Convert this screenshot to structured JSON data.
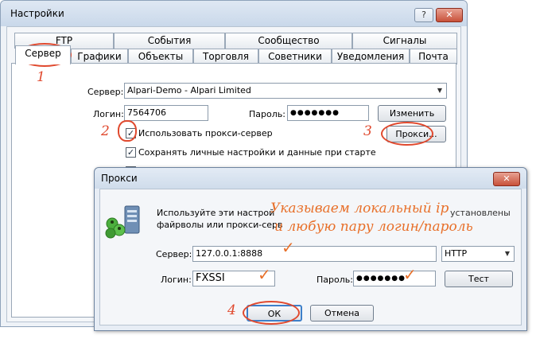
{
  "settings_window": {
    "title": "Настройки",
    "help_button": "?",
    "close_button": "✕",
    "tabs_row1": [
      "FTP",
      "События",
      "Сообщество",
      "Сигналы"
    ],
    "tabs_row2": [
      "Сервер",
      "Графики",
      "Объекты",
      "Торговля",
      "Советники",
      "Уведомления",
      "Почта"
    ],
    "server_label": "Сервер:",
    "server_value": "Alpari-Demo - Alpari Limited",
    "login_label": "Логин:",
    "login_value": "7564706",
    "password_label": "Пароль:",
    "password_value": "●●●●●●●",
    "change_button": "Изменить",
    "use_proxy_checkbox": {
      "checked": "✓",
      "label": "Использовать прокси-сервер"
    },
    "proxy_button": "Прокси...",
    "save_settings_checkbox": {
      "checked": "✓",
      "label": "Сохранять личные настройки и данные при старте"
    }
  },
  "proxy_dialog": {
    "title": "Прокси",
    "close_button": "✕",
    "description_line1": "Используйте эти настрой",
    "description_line2": "файрволы или прокси-серв",
    "description_tail": "установлены",
    "server_label": "Сервер:",
    "server_value": "127.0.0.1:8888",
    "type_value": "HTTP",
    "login_label": "Логин:",
    "login_value": "FXSSI",
    "password_label": "Пароль:",
    "password_value": "●●●●●●●",
    "test_button": "Тест",
    "ok_button": "ОК",
    "cancel_button": "Отмена"
  },
  "annotations": {
    "step1": "1",
    "step2": "2",
    "step3": "3",
    "step4": "4",
    "note_line1": "Указываем локальный ip",
    "note_line2": "и любую пару логин/пароль",
    "tick": "✓",
    "color": "#e0492e"
  }
}
